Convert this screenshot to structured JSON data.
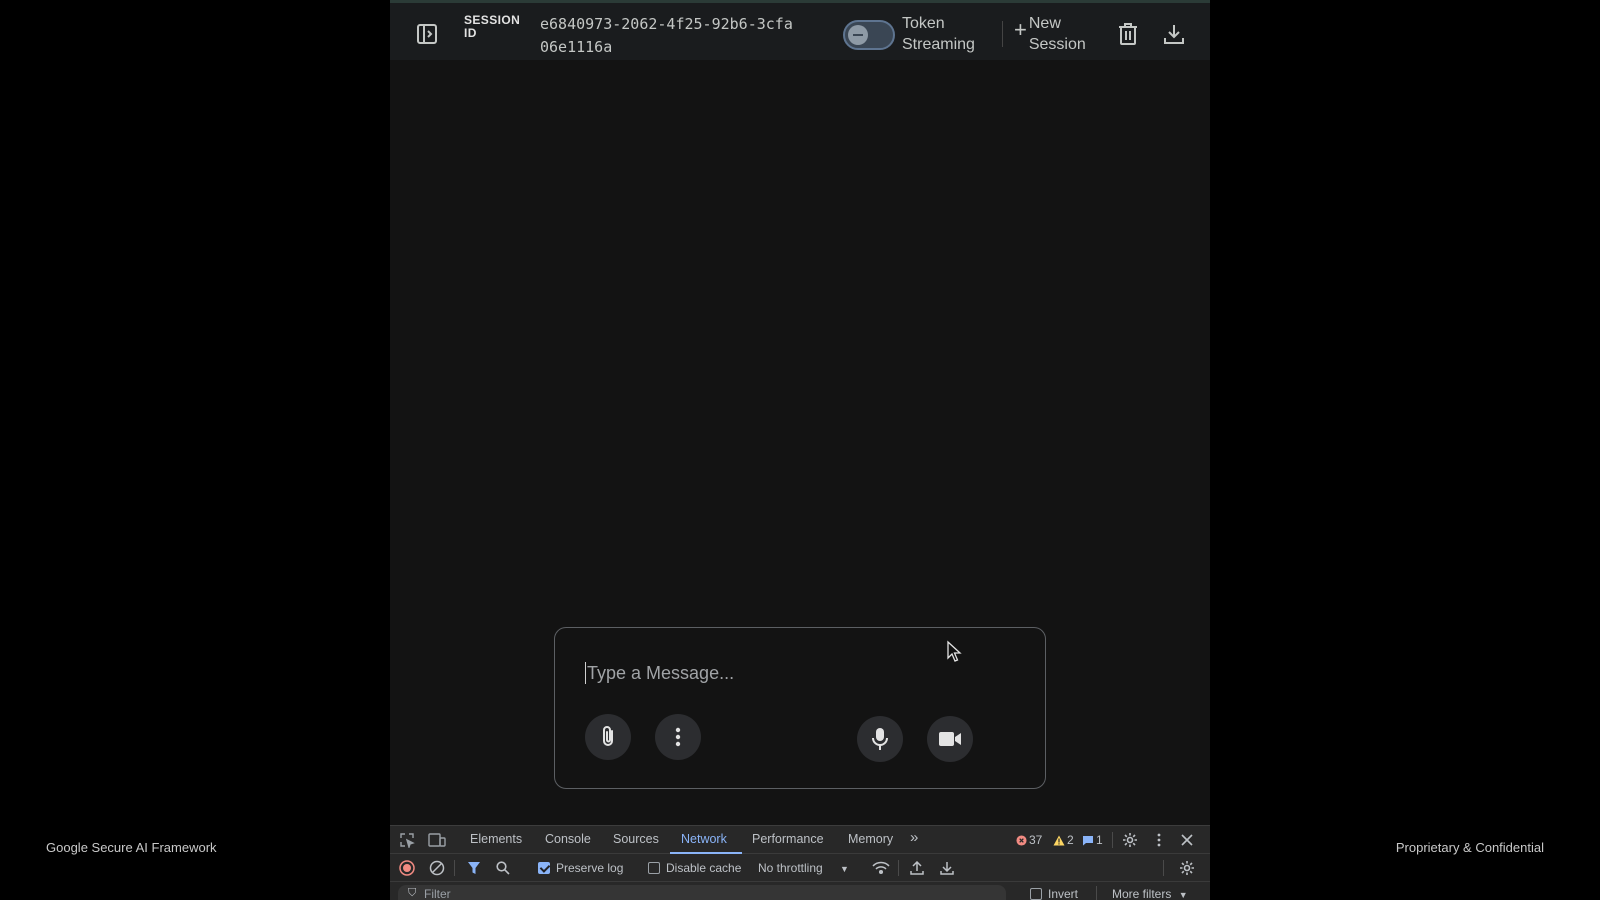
{
  "footer": {
    "left_text": "Google Secure AI Framework",
    "right_text": "Proprietary & Confidential"
  },
  "header": {
    "session_label": "SESSION ID",
    "session_id": "e6840973-2062-4f25-92b6-3cfa06e1116a",
    "token_streaming_label": "Token Streaming",
    "token_streaming_enabled": false,
    "new_session_label": "New Session"
  },
  "composer": {
    "placeholder": "Type a Message...",
    "value": ""
  },
  "devtools": {
    "tabs": [
      "Elements",
      "Console",
      "Sources",
      "Network",
      "Performance",
      "Memory"
    ],
    "active_tab": "Network",
    "error_count": "37",
    "warning_count": "2",
    "message_count": "1",
    "preserve_log_label": "Preserve log",
    "preserve_log_checked": true,
    "disable_cache_label": "Disable cache",
    "disable_cache_checked": false,
    "throttling_value": "No throttling",
    "filter_placeholder": "Filter",
    "invert_label": "Invert",
    "more_filters_label": "More filters"
  },
  "colors": {
    "app_bg": "#131313",
    "topbar_bg": "#1a1c1e",
    "accent": "#8ab4f8",
    "error": "#f28b82",
    "warning": "#fdd663"
  }
}
